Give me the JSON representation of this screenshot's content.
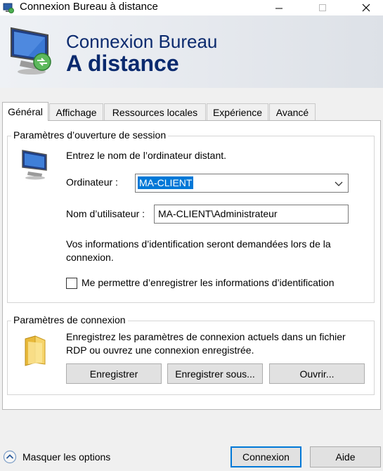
{
  "window": {
    "title": "Connexion Bureau à distance",
    "controls": [
      "minimize-icon",
      "maximize-icon",
      "close-icon"
    ]
  },
  "banner": {
    "line1": "Connexion Bureau",
    "line2": "A distance",
    "icon": "remote-desktop-monitor-icon"
  },
  "tabs": [
    {
      "label": "Général",
      "selected": true
    },
    {
      "label": "Affichage",
      "selected": false
    },
    {
      "label": "Ressources locales",
      "selected": false
    },
    {
      "label": "Expérience",
      "selected": false
    },
    {
      "label": "Avancé",
      "selected": false
    }
  ],
  "session_group": {
    "legend": "Paramètres d’ouverture de session",
    "intro": "Entrez le nom de l’ordinateur distant.",
    "computer_label": "Ordinateur :",
    "computer_value": "MA-CLIENT",
    "user_label": "Nom d’utilisateur :",
    "user_value": "MA-CLIENT\\Administrateur",
    "cred_note": "Vos informations d’identification seront demandées lors de la connexion.",
    "save_cred_label": "Me permettre d’enregistrer les informations d’identification",
    "save_cred_checked": false
  },
  "connection_group": {
    "legend": "Paramètres de connexion",
    "description": "Enregistrez les paramètres de connexion actuels dans un fichier RDP ou ouvrez une connexion enregistrée.",
    "buttons": {
      "save": "Enregistrer",
      "save_as": "Enregistrer sous...",
      "open": "Ouvrir..."
    }
  },
  "footer": {
    "options_label": "Masquer les options",
    "connect": "Connexion",
    "help": "Aide"
  },
  "colors": {
    "accent": "#0078d7",
    "banner_text": "#0b2a6e",
    "dialog_bg": "#f0f0f0"
  }
}
